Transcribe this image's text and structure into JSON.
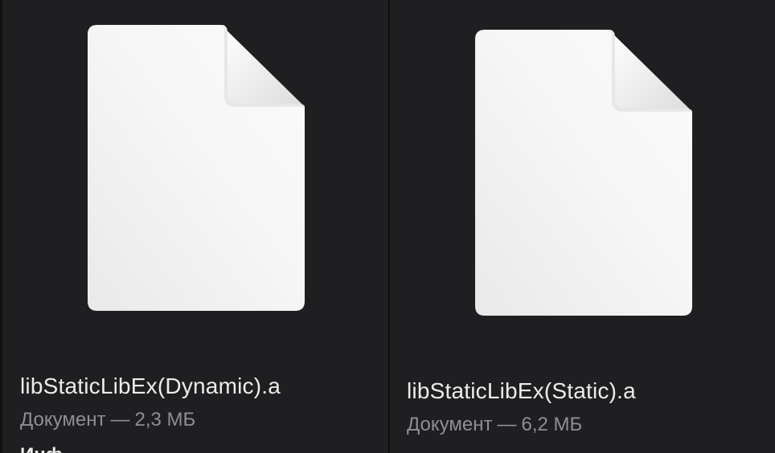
{
  "files": [
    {
      "name": "libStaticLibEx(Dynamic).a",
      "kind": "Документ",
      "separator": "—",
      "size": "2,3 МБ",
      "icon": "generic-document-icon"
    },
    {
      "name": "libStaticLibEx(Static).a",
      "kind": "Документ",
      "separator": "—",
      "size": "6,2 МБ",
      "icon": "generic-document-icon"
    }
  ],
  "more_section_label": "Инф",
  "colors": {
    "background": "#1f1f22",
    "title_text": "#ececec",
    "meta_text": "#8f8f93",
    "document_page": "#f4f4f4"
  }
}
